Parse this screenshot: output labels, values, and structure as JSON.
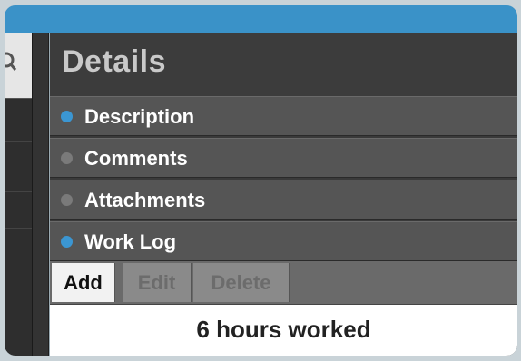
{
  "details": {
    "title": "Details",
    "sections": [
      {
        "label": "Description",
        "dot_color": "#3b96d2"
      },
      {
        "label": "Comments",
        "dot_color": "#7a7a7a"
      },
      {
        "label": "Attachments",
        "dot_color": "#7a7a7a"
      },
      {
        "label": "Work Log",
        "dot_color": "#3b96d2"
      }
    ]
  },
  "toolbar": {
    "add_label": "Add",
    "edit_label": "Edit",
    "delete_label": "Delete"
  },
  "worklog": {
    "summary": "6 hours worked"
  },
  "colors": {
    "titlebar": "#3a92c8",
    "accent_dot": "#3b96d2",
    "inactive_dot": "#7a7a7a"
  }
}
